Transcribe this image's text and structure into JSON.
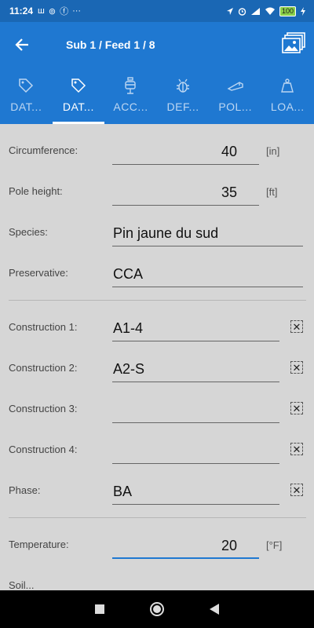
{
  "status": {
    "time": "11:24",
    "notif_icons": [
      "ш",
      "⊚",
      "ⓕ",
      "···"
    ],
    "battery": "100"
  },
  "app_bar": {
    "title": "Sub 1 / Feed 1 / 8"
  },
  "tabs": [
    {
      "label": "DAT...",
      "icon": "tag-icon"
    },
    {
      "label": "DAT...",
      "icon": "tag-icon"
    },
    {
      "label": "ACC...",
      "icon": "lamp-icon"
    },
    {
      "label": "DEF...",
      "icon": "bug-icon"
    },
    {
      "label": "POL...",
      "icon": "pole-icon"
    },
    {
      "label": "LOA...",
      "icon": "weight-icon"
    }
  ],
  "form": {
    "circumference": {
      "label": "Circumference:",
      "value": "40",
      "unit": "[in]"
    },
    "pole_height": {
      "label": "Pole height:",
      "value": "35",
      "unit": "[ft]"
    },
    "species": {
      "label": "Species:",
      "value": "Pin jaune du sud"
    },
    "preservative": {
      "label": "Preservative:",
      "value": "CCA"
    },
    "construction1": {
      "label": "Construction 1:",
      "value": "A1-4"
    },
    "construction2": {
      "label": "Construction 2:",
      "value": "A2-S"
    },
    "construction3": {
      "label": "Construction 3:",
      "value": ""
    },
    "construction4": {
      "label": "Construction 4:",
      "value": ""
    },
    "phase": {
      "label": "Phase:",
      "value": "BA"
    },
    "temperature": {
      "label": "Temperature:",
      "value": "20",
      "unit": "[°F]"
    },
    "partial_label": "Soil...",
    "clear_glyph": "✕"
  }
}
